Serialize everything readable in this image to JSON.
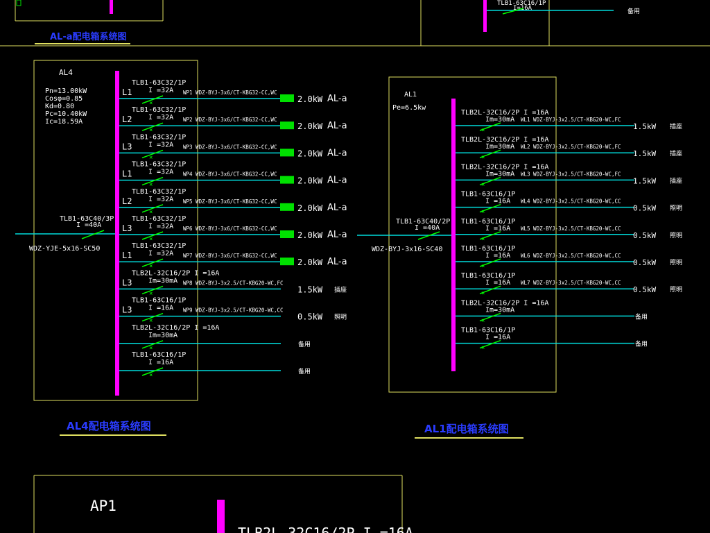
{
  "colors": {
    "background": "#000000",
    "frame": "#e0e060",
    "feeder": "#00dcdc",
    "busbar": "#ff00ff",
    "load": "#00e000",
    "text": "#ffffff",
    "title": "#2a3cff",
    "underline": "#e0e060",
    "switch": "#00ff00"
  },
  "top_strip": {
    "left_title": "AL-a配电箱系统图",
    "right_circuit_breaker": "TLB1-63C16/1P",
    "right_circuit_rating": "I=16A",
    "right_circuit_note": "备用"
  },
  "al4": {
    "name": "AL4",
    "params": [
      "Pn=13.00kW",
      "Cosφ=0.85",
      "Kd=0.80",
      "Pc=10.40kW",
      "Ic=18.59A"
    ],
    "incoming_breaker": "TLB1-63C40/3P",
    "incoming_rating": "I =40A",
    "incoming_cable": "WDZ-YJE-5x16-SC50",
    "title": "AL4配电箱系统图",
    "circuits": [
      {
        "phase": "L1",
        "breaker": "TLB1-63C32/1P",
        "rating": "I =32A",
        "cable": "WP1 WDZ-BYJ-3x6/CT-KBG32-CC,WC",
        "power": "2.0kW",
        "dest": "AL-a",
        "load_box": true
      },
      {
        "phase": "L2",
        "breaker": "TLB1-63C32/1P",
        "rating": "I =32A",
        "cable": "WP2 WDZ-BYJ-3x6/CT-KBG32-CC,WC",
        "power": "2.0kW",
        "dest": "AL-a",
        "load_box": true
      },
      {
        "phase": "L3",
        "breaker": "TLB1-63C32/1P",
        "rating": "I =32A",
        "cable": "WP3 WDZ-BYJ-3x6/CT-KBG32-CC,WC",
        "power": "2.0kW",
        "dest": "AL-a",
        "load_box": true
      },
      {
        "phase": "L1",
        "breaker": "TLB1-63C32/1P",
        "rating": "I =32A",
        "cable": "WP4 WDZ-BYJ-3x6/CT-KBG32-CC,WC",
        "power": "2.0kW",
        "dest": "AL-a",
        "load_box": true
      },
      {
        "phase": "L2",
        "breaker": "TLB1-63C32/1P",
        "rating": "I =32A",
        "cable": "WP5 WDZ-BYJ-3x6/CT-KBG32-CC,WC",
        "power": "2.0kW",
        "dest": "AL-a",
        "load_box": true
      },
      {
        "phase": "L3",
        "breaker": "TLB1-63C32/1P",
        "rating": "I =32A",
        "cable": "WP6 WDZ-BYJ-3x6/CT-KBG32-CC,WC",
        "power": "2.0kW",
        "dest": "AL-a",
        "load_box": true
      },
      {
        "phase": "L1",
        "breaker": "TLB1-63C32/1P",
        "rating": "I =32A",
        "cable": "WP7 WDZ-BYJ-3x6/CT-KBG32-CC,WC",
        "power": "2.0kW",
        "dest": "AL-a",
        "load_box": true
      },
      {
        "phase": "L3",
        "breaker": "TLB2L-32C16/2P I =16A",
        "rating": "Im=30mA",
        "cable": "WP8 WDZ-BYJ-3x2.5/CT-KBG20-WC,FC",
        "power": "1.5kW",
        "dest": "插座",
        "load_box": false
      },
      {
        "phase": "L3",
        "breaker": "TLB1-63C16/1P",
        "rating": "I =16A",
        "cable": "WP9 WDZ-BYJ-3x2.5/CT-KBG20-WC,CC",
        "power": "0.5kW",
        "dest": "照明",
        "load_box": false
      },
      {
        "phase": "",
        "breaker": "TLB2L-32C16/2P I =16A",
        "rating": "Im=30mA",
        "cable": "",
        "power": "",
        "dest": "备用",
        "load_box": false
      },
      {
        "phase": "",
        "breaker": "TLB1-63C16/1P",
        "rating": "I =16A",
        "cable": "",
        "power": "",
        "dest": "备用",
        "load_box": false
      }
    ]
  },
  "al1": {
    "name": "AL1",
    "params": [
      "Pe=6.5kw"
    ],
    "incoming_breaker": "TLB1-63C40/2P",
    "incoming_rating": "I =40A",
    "incoming_cable": "WDZ-BYJ-3x16-SC40",
    "title": "AL1配电箱系统图",
    "circuits": [
      {
        "breaker": "TLB2L-32C16/2P I =16A",
        "rating": "Im=30mA",
        "cable": "WL1 WDZ-BYJ-3x2.5/CT-KBG20-WC,FC",
        "power": "1.5kW",
        "dest": "插座"
      },
      {
        "breaker": "TLB2L-32C16/2P I =16A",
        "rating": "Im=30mA",
        "cable": "WL2 WDZ-BYJ-3x2.5/CT-KBG20-WC,FC",
        "power": "1.5kW",
        "dest": "插座"
      },
      {
        "breaker": "TLB2L-32C16/2P I =16A",
        "rating": "Im=30mA",
        "cable": "WL3 WDZ-BYJ-3x2.5/CT-KBG20-WC,FC",
        "power": "1.5kW",
        "dest": "插座"
      },
      {
        "breaker": "TLB1-63C16/1P",
        "rating": "I =16A",
        "cable": "WL4 WDZ-BYJ-3x2.5/CT-KBG20-WC,CC",
        "power": "0.5kW",
        "dest": "照明"
      },
      {
        "breaker": "TLB1-63C16/1P",
        "rating": "I =16A",
        "cable": "WL5 WDZ-BYJ-3x2.5/CT-KBG20-WC,CC",
        "power": "0.5kW",
        "dest": "照明"
      },
      {
        "breaker": "TLB1-63C16/1P",
        "rating": "I =16A",
        "cable": "WL6 WDZ-BYJ-3x2.5/CT-KBG20-WC,CC",
        "power": "0.5kW",
        "dest": "照明"
      },
      {
        "breaker": "TLB1-63C16/1P",
        "rating": "I =16A",
        "cable": "WL7 WDZ-BYJ-3x2.5/CT-KBG20-WC,CC",
        "power": "0.5kW",
        "dest": "照明"
      },
      {
        "breaker": "TLB2L-32C16/2P I =16A",
        "rating": "Im=30mA",
        "cable": "",
        "power": "",
        "dest": "备用"
      },
      {
        "breaker": "TLB1-63C16/1P",
        "rating": "I =16A",
        "cable": "",
        "power": "",
        "dest": "备用"
      }
    ]
  },
  "ap1": {
    "name": "AP1",
    "breaker_partial": "TLB2L-32C16/2P I =16A"
  }
}
